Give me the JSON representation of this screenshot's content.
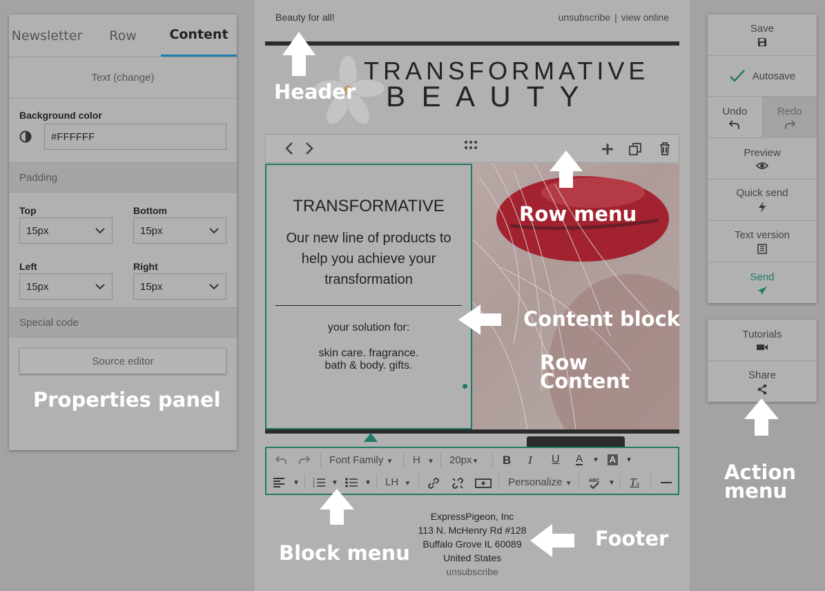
{
  "properties_panel": {
    "tabs": [
      {
        "label": "Newsletter"
      },
      {
        "label": "Row"
      },
      {
        "label": "Content"
      }
    ],
    "text_change": "Text (change)",
    "background_color": {
      "label": "Background color",
      "value": "#FFFFFF"
    },
    "padding": {
      "label": "Padding",
      "top": {
        "label": "Top",
        "value": "15px"
      },
      "bottom": {
        "label": "Bottom",
        "value": "15px"
      },
      "left": {
        "label": "Left",
        "value": "15px"
      },
      "right": {
        "label": "Right",
        "value": "15px"
      }
    },
    "special_code": "Special code",
    "source_editor": "Source editor"
  },
  "email": {
    "preheader": "Beauty for all!",
    "unsubscribe": "unsubscribe",
    "divider": "|",
    "view_online": "view online",
    "logo_line1": "TRANSFORMATIVE",
    "logo_line2": "B E A U T Y",
    "content": {
      "heading": "TRANSFORMATIVE",
      "body": "Our new line of products to help you achieve your transformation",
      "solution": "your solution for:",
      "line1": "skin care. fragrance.",
      "line2": "bath & body. gifts."
    },
    "footer": {
      "company": "ExpressPigeon, Inc",
      "address1": "113 N. McHenry Rd #128",
      "address2": "Buffalo Grove IL 60089",
      "country": "United States",
      "unsubscribe": "unsubscribe"
    }
  },
  "block_menu": {
    "font_family": "Font Family",
    "heading": "H",
    "font_size": "20px",
    "line_height": "LH",
    "personalize": "Personalize"
  },
  "action_menu": {
    "save": "Save",
    "autosave": "Autosave",
    "undo": "Undo",
    "redo": "Redo",
    "preview": "Preview",
    "quick_send": "Quick send",
    "text_version": "Text version",
    "send": "Send",
    "tutorials": "Tutorials",
    "share": "Share"
  },
  "callouts": {
    "header": "Header",
    "row_menu": "Row menu",
    "content_block": "Content block",
    "row_content_1": "Row",
    "row_content_2": "Content",
    "properties_panel": "Properties panel",
    "block_menu": "Block menu",
    "footer": "Footer",
    "action_menu_1": "Action",
    "action_menu_2": "menu"
  },
  "colors": {
    "accent": "#1a7fb0",
    "teal": "#1f7a66",
    "send": "#1d7d6a",
    "overlay_bg": "#a3a3a3"
  }
}
